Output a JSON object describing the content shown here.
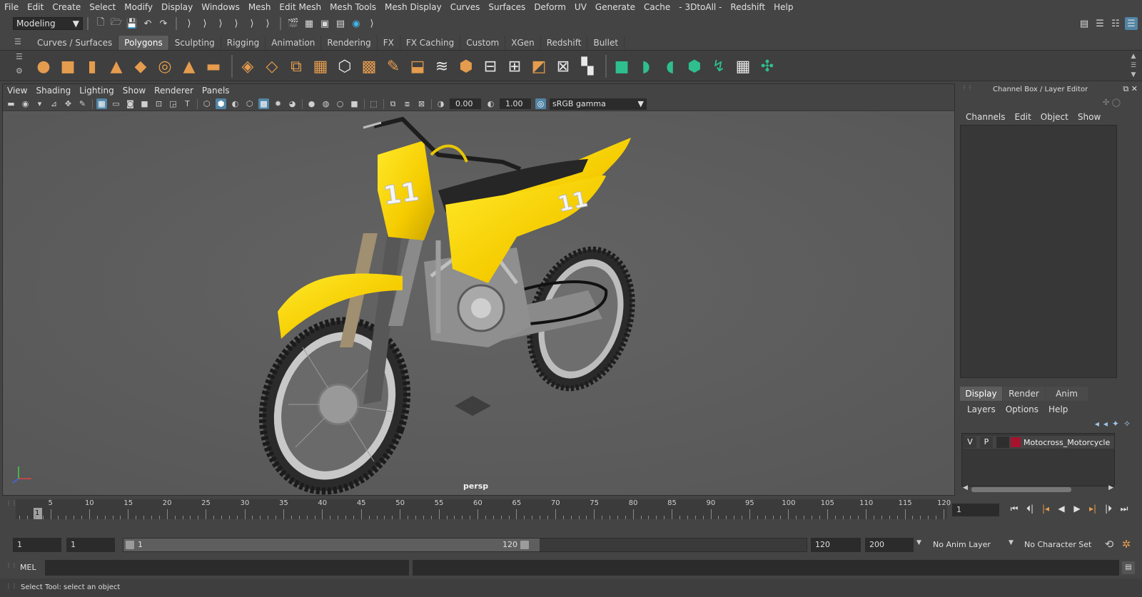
{
  "menubar": [
    "File",
    "Edit",
    "Create",
    "Select",
    "Modify",
    "Display",
    "Windows",
    "Mesh",
    "Edit Mesh",
    "Mesh Tools",
    "Mesh Display",
    "Curves",
    "Surfaces",
    "Deform",
    "UV",
    "Generate",
    "Cache",
    "- 3DtoAll -",
    "Redshift",
    "Help"
  ],
  "mode": "Modeling",
  "shelf_tabs": [
    "Curves / Surfaces",
    "Polygons",
    "Sculpting",
    "Rigging",
    "Animation",
    "Rendering",
    "FX",
    "FX Caching",
    "Custom",
    "XGen",
    "Redshift",
    "Bullet"
  ],
  "shelf_active_tab": "Polygons",
  "viewport": {
    "menu": [
      "View",
      "Shading",
      "Lighting",
      "Show",
      "Renderer",
      "Panels"
    ],
    "exposure": "0.00",
    "gamma": "1.00",
    "color_space": "sRGB gamma",
    "camera": "persp"
  },
  "channel_box": {
    "title": "Channel Box / Layer Editor",
    "menu": [
      "Channels",
      "Edit",
      "Object",
      "Show"
    ]
  },
  "layer_editor": {
    "tabs": [
      "Display",
      "Render",
      "Anim"
    ],
    "active_tab": "Display",
    "menu": [
      "Layers",
      "Options",
      "Help"
    ],
    "layers": [
      {
        "v": "V",
        "p": "P",
        "color": "#a7122d",
        "name": "Motocross_Motorcycle"
      }
    ]
  },
  "timeline": {
    "start": 1,
    "end": 120,
    "labels": [
      5,
      10,
      15,
      20,
      25,
      30,
      35,
      40,
      45,
      50,
      55,
      60,
      65,
      70,
      75,
      80,
      85,
      90,
      95,
      100,
      105,
      110,
      115,
      120
    ],
    "current_frame_marker": "1",
    "current_frame": "1"
  },
  "range": {
    "start_field": "1",
    "playback_start": "1",
    "range_start_label": "1",
    "range_end_label": "120",
    "playback_end": "120",
    "end_field": "200",
    "anim_layer": "No Anim Layer",
    "character_set": "No Character Set"
  },
  "command_line": {
    "label": "MEL"
  },
  "help_line": "Select Tool: select an object",
  "colors": {
    "bike_yellow": "#ffd400",
    "layer_color": "#a7122d",
    "active_blue": "#5285a6"
  }
}
